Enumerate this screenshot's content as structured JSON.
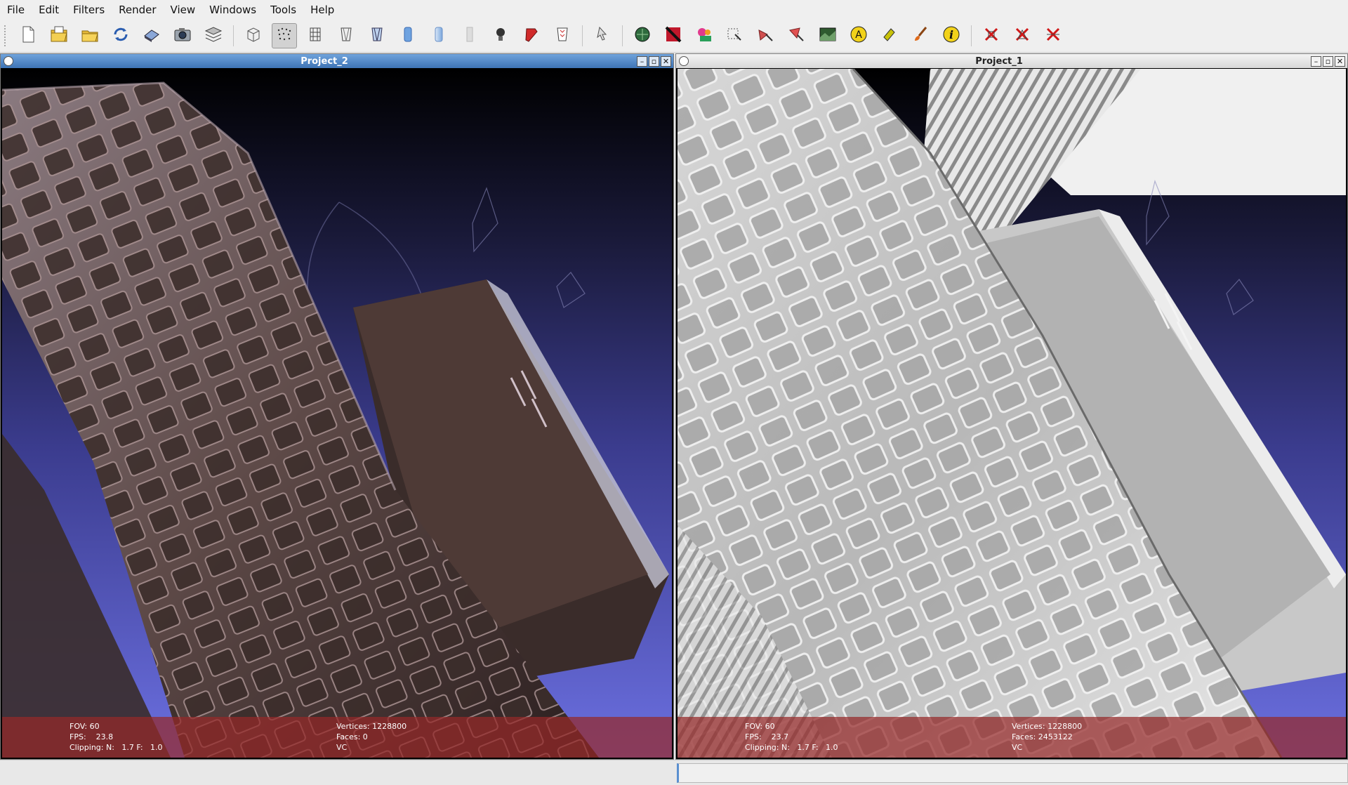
{
  "menu": [
    "File",
    "Edit",
    "Filters",
    "Render",
    "View",
    "Windows",
    "Tools",
    "Help"
  ],
  "toolbar_icons": [
    "new-project-icon",
    "open-project-icon",
    "import-mesh-icon",
    "reload-icon",
    "export-mesh-icon",
    "snapshot-icon",
    "layers-icon",
    "bounding-box-icon",
    "points-icon",
    "wireframe-icon",
    "hidden-lines-icon",
    "flat-lines-icon",
    "flat-icon",
    "smooth-icon",
    "texture-icon",
    "light-icon",
    "two-sided-light-icon",
    "lock-icon",
    "select-icon",
    "align-icon",
    "color-icon",
    "dimensions-icon",
    "pick-points-icon",
    "measure-icon",
    "select-faces-icon",
    "select-vertices-icon",
    "raster-icon",
    "annotation-icon",
    "paint-icon",
    "brush-icon",
    "info-icon",
    "delete-faces-icon",
    "delete-vertices-icon",
    "delete-selection-icon"
  ],
  "windows": {
    "left": {
      "title": "Project_2",
      "controls": {
        "minimize": "–",
        "restore": "▫",
        "close": "✕"
      },
      "overlay": {
        "fov": "FOV: 60",
        "fps": "FPS:    23.8",
        "clipping": "Clipping: N:   1.7 F:   1.0",
        "vertices": "Vertices: 1228800",
        "faces": "Faces: 0",
        "mode": "VC"
      }
    },
    "right": {
      "title": "Project_1",
      "controls": {
        "minimize": "–",
        "restore": "▫",
        "close": "✕"
      },
      "overlay": {
        "fov": "FOV: 60",
        "fps": "FPS:    23.7",
        "clipping": "Clipping: N:   1.7 F:   1.0",
        "vertices": "Vertices: 1228800",
        "faces": "Faces: 2453122",
        "mode": "VC"
      }
    }
  },
  "colors": {
    "viewport_top": "#000000",
    "viewport_bottom": "#6b6fe0",
    "overlay": "#962828",
    "active_title": "#4a80c0"
  }
}
